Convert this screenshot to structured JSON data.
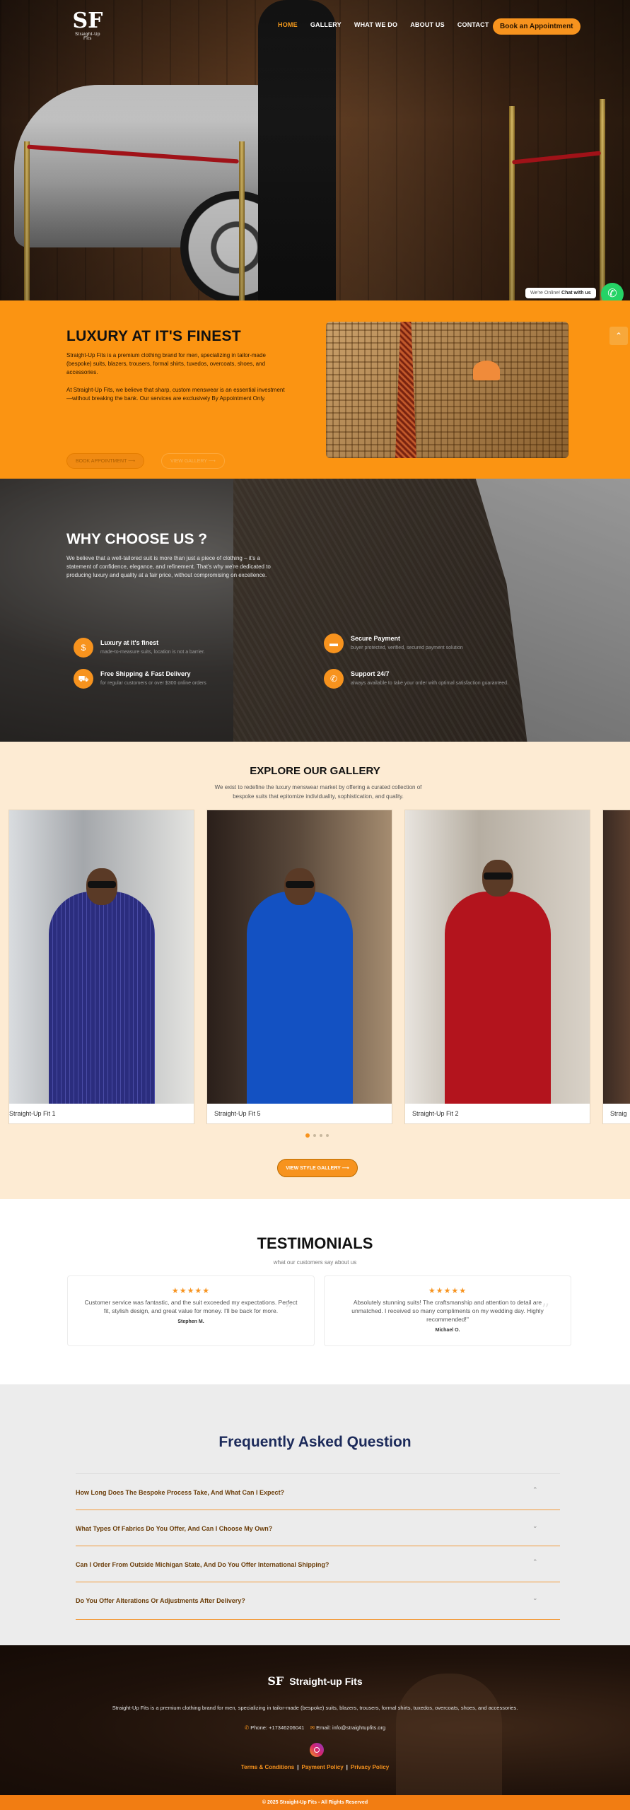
{
  "brand": {
    "logo_mark": "SF",
    "logo_sub": "Straight-Up Fits",
    "footer_name": "Straight-up Fits"
  },
  "nav": {
    "items": [
      "HOME",
      "GALLERY",
      "WHAT WE DO",
      "ABOUT US",
      "CONTACT"
    ],
    "active": "HOME",
    "book_label": "Book an Appointment"
  },
  "chat": {
    "online": "We're Online!",
    "cta": "Chat with us"
  },
  "luxury": {
    "title": "LUXURY AT IT'S FINEST",
    "para1": "Straight-Up Fits is a premium clothing brand for men, specializing in tailor-made (bespoke) suits, blazers, trousers, formal shirts, tuxedos, overcoats, shoes, and accessories.",
    "para2": "At Straight-Up Fits, we believe that sharp, custom menswear is an essential investment—without breaking the bank. Our services are exclusively By Appointment Only.",
    "btn_book": "BOOK APPOINTMENT",
    "btn_gallery": "VIEW GALLERY"
  },
  "why": {
    "title": "WHY CHOOSE US ?",
    "lead": "We believe that a well-tailored suit is more than just a piece of clothing – it's a statement of confidence, elegance, and refinement. That's why we're dedicated to producing luxury and quality at a fair price, without compromising on excellence.",
    "features": [
      {
        "icon": "dollar-icon",
        "glyph": "$",
        "title": "Luxury at it's finest",
        "text": "made-to-measure suits, location is not a barrier."
      },
      {
        "icon": "card-icon",
        "glyph": "▬",
        "title": "Secure Payment",
        "text": "buyer protected, verified, secured payment solution"
      },
      {
        "icon": "truck-icon",
        "glyph": "⛟",
        "title": "Free Shipping & Fast Delivery",
        "text": "for regular customers or over $300 online orders"
      },
      {
        "icon": "phone-icon",
        "glyph": "✆",
        "title": "Support 24/7",
        "text": "always available to take your order with optimal satisfaction guaranteed."
      }
    ]
  },
  "gallery": {
    "title": "EXPLORE OUR GALLERY",
    "sub": "We exist to redefine the luxury menswear market by offering a curated collection of bespoke suits that epitomize individuality, sophistication, and quality.",
    "cards": [
      {
        "caption": "Straight-Up Fit 1",
        "suit_color": "#2b2d7e"
      },
      {
        "caption": "Straight-Up Fit 5",
        "suit_color": "#1351c2"
      },
      {
        "caption": "Straight-Up Fit 2",
        "suit_color": "#b3141d"
      },
      {
        "caption": "Straig",
        "suit_color": "#8a2a20"
      }
    ],
    "button": "VIEW STYLE GALLERY"
  },
  "testimonials": {
    "title": "TESTIMONIALS",
    "sub": "what our customers say about us",
    "items": [
      {
        "stars": "★★★★★",
        "quote": "Customer service was fantastic, and the suit exceeded my expectations. Perfect fit, stylish design, and great value for money. I'll be back for more.",
        "name": "Stephen M."
      },
      {
        "stars": "★★★★★",
        "quote": "Absolutely stunning suits! The craftsmanship and attention to detail are unmatched. I received so many compliments on my wedding day. Highly recommended!\"",
        "name": "Michael O."
      }
    ]
  },
  "faq": {
    "title": "Frequently Asked Question",
    "items": [
      "How Long Does The Bespoke Process Take, And What Can I Expect?",
      "What Types Of Fabrics Do You Offer, And Can I Choose My Own?",
      "Can I Order From Outside Michigan State, And Do You Offer International Shipping?",
      "Do You Offer Alterations Or Adjustments After Delivery?"
    ]
  },
  "footer": {
    "desc": "Straight-Up Fits is a premium clothing brand for men, specializing in tailor-made (bespoke) suits, blazers, trousers, formal shirts, tuxedos, overcoats, shoes, and accessories.",
    "phone": "Phone: +17346206041",
    "email": "Email: info@straightupfits.org",
    "links": [
      "Terms & Conditions",
      "Payment Policy",
      "Privacy Policy"
    ],
    "copyright": "© 2025 Straight-Up Fits - All Rights Reserved"
  },
  "colors": {
    "accent": "#f7931e",
    "faq_title": "#1c2a5a"
  }
}
